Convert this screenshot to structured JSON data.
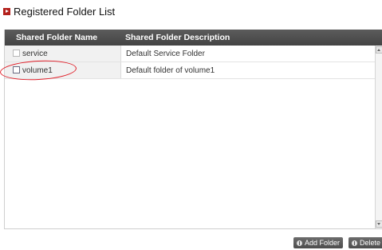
{
  "title": "Registered Folder List",
  "table": {
    "columns": [
      "Shared Folder Name",
      "Shared Folder Description"
    ],
    "rows": [
      {
        "name": "service",
        "description": "Default Service Folder"
      },
      {
        "name": "volume1",
        "description": "Default folder of volume1"
      }
    ]
  },
  "actions": {
    "add_label": "Add Folder",
    "delete_label": "Delete"
  },
  "colors": {
    "header_bg": "#4f4f4f",
    "title_icon": "#b3201c",
    "highlight": "#e0202a"
  }
}
